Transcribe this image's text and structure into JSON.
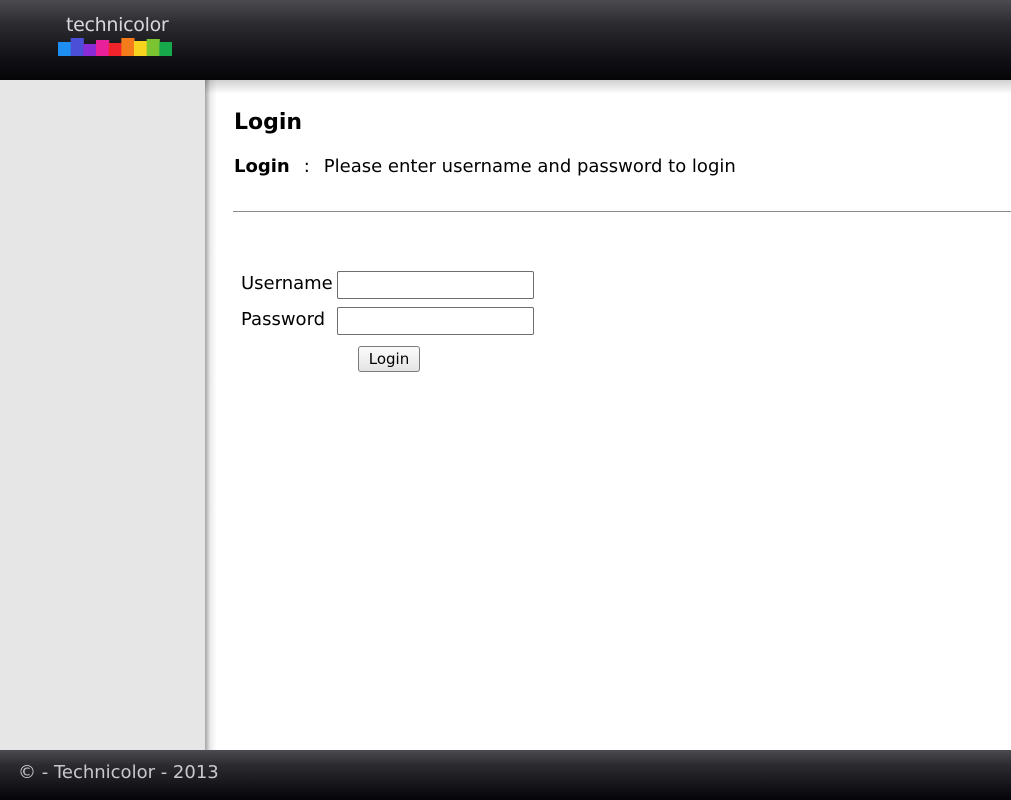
{
  "header": {
    "logo_text": "technicolor",
    "logo_colors": [
      "#1e8ff0",
      "#4b4fd8",
      "#8a2bd8",
      "#e8209a",
      "#f2232a",
      "#f47c1a",
      "#f6d31e",
      "#7ac431",
      "#17a84c"
    ]
  },
  "main": {
    "title": "Login",
    "intro_label": "Login",
    "intro_separator": ":",
    "intro_text": "Please enter username and password to login"
  },
  "form": {
    "username_label": "Username",
    "username_value": "",
    "password_label": "Password",
    "password_value": "",
    "submit_label": "Login"
  },
  "footer": {
    "text": "© - Technicolor - 2013"
  }
}
